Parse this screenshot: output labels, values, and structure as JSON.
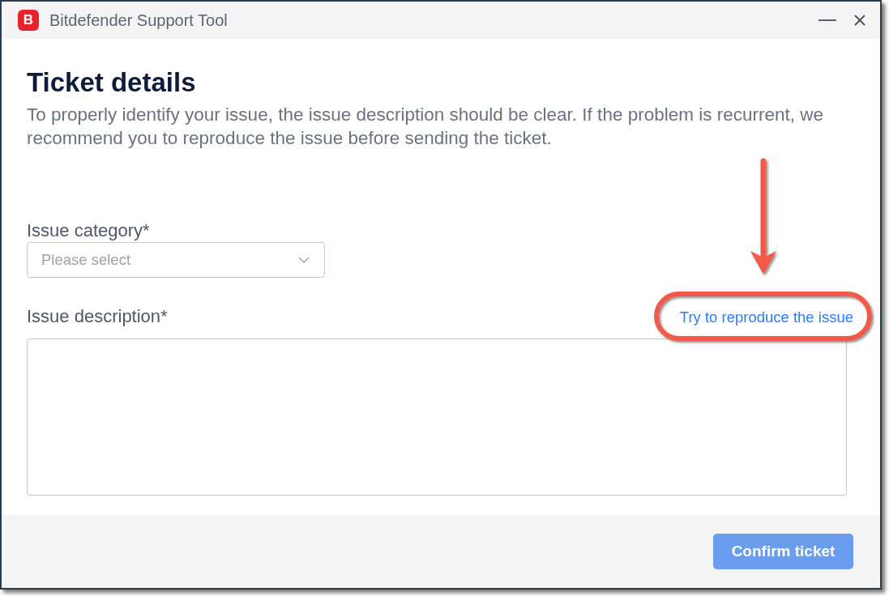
{
  "window": {
    "logo": "B",
    "title": "Bitdefender Support Tool"
  },
  "heading": "Ticket details",
  "description": "To properly identify your issue, the issue description should be clear. If the problem is recurrent, we recommend you to reproduce the issue before sending the ticket.",
  "issue_category": {
    "label": "Issue category*",
    "placeholder": "Please select"
  },
  "issue_description": {
    "label": "Issue description*",
    "link": {
      "text": "Try to reproduce the issue",
      "highlighted": true
    }
  },
  "confirm_button": {
    "label": "Confirm ticket",
    "disabled": true
  }
}
